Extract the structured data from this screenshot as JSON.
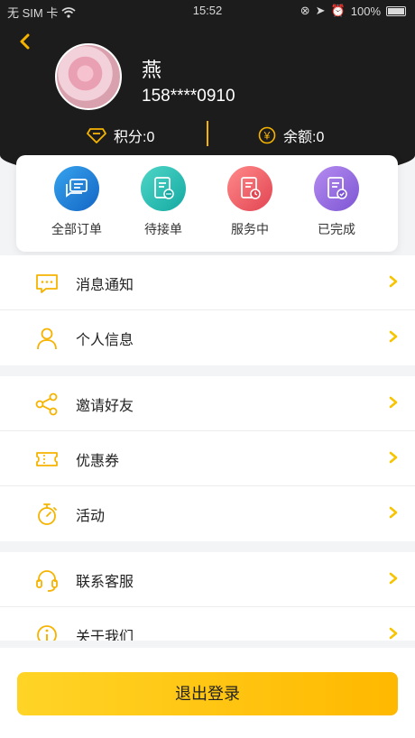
{
  "status_bar": {
    "carrier": "无 SIM 卡",
    "time": "15:52",
    "battery": "100%"
  },
  "profile": {
    "name": "燕",
    "phone": "158****0910",
    "points_label": "积分:0",
    "balance_label": "余额:0"
  },
  "orders": [
    {
      "label": "全部订单",
      "color": "#1f87d6"
    },
    {
      "label": "待接单",
      "color": "#1bb9b3"
    },
    {
      "label": "服务中",
      "color": "#ef5c66"
    },
    {
      "label": "已完成",
      "color": "#9c73df"
    }
  ],
  "menu": {
    "group1": [
      {
        "label": "消息通知",
        "icon": "message-icon"
      },
      {
        "label": "个人信息",
        "icon": "person-icon"
      }
    ],
    "group2": [
      {
        "label": "邀请好友",
        "icon": "share-icon"
      },
      {
        "label": "优惠券",
        "icon": "coupon-icon"
      },
      {
        "label": "活动",
        "icon": "stopwatch-icon"
      }
    ],
    "group3": [
      {
        "label": "联系客服",
        "icon": "headset-icon"
      },
      {
        "label": "关于我们",
        "icon": "info-icon"
      }
    ]
  },
  "logout": {
    "label": "退出登录"
  },
  "colors": {
    "accent": "#f6b300",
    "header_bg": "#1c1c1c",
    "button_start": "#ffd426",
    "button_end": "#ffb800"
  }
}
